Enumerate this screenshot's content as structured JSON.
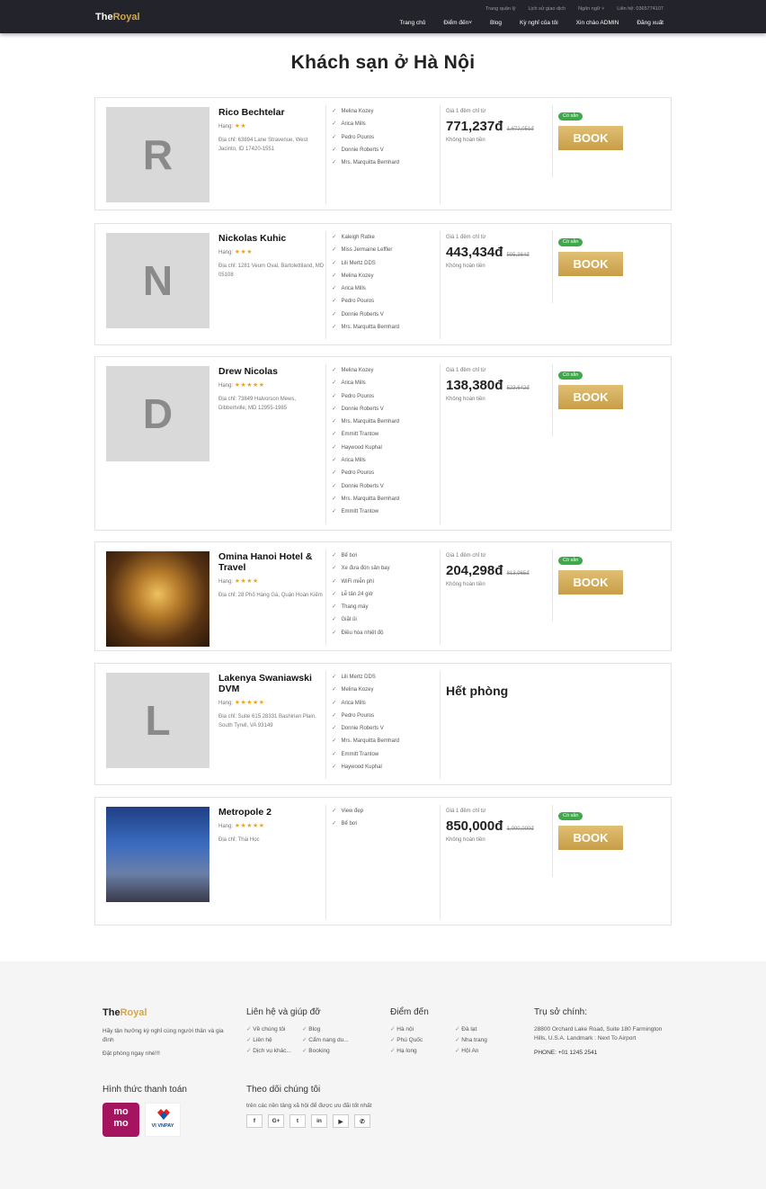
{
  "header": {
    "logo_a": "The",
    "logo_b": "Royal",
    "top_links": [
      "Trang quản lý",
      "Lịch sử giao dịch",
      "Ngôn ngữ ˅",
      "Liên hệ: 0365774107"
    ],
    "nav": [
      "Trang chủ",
      "Điểm đến˅",
      "Blog",
      "Kỳ nghỉ của tôi",
      "Xin chào ADMIN",
      "Đăng xuất"
    ]
  },
  "page_title": "Khách sạn ở Hà Nội",
  "labels": {
    "rank": "Hạng:",
    "price_from": "Giá 1 đêm chỉ từ",
    "refund": "Không hoàn tiền",
    "available": "Có sẵn",
    "book": "BOOK",
    "sold_out": "Hết phòng"
  },
  "hotels": [
    {
      "letter": "R",
      "name": "Rico Bechtelar",
      "stars": "★★",
      "address": "Địa chỉ: 63894 Lane Stravenue, West Jacinto, ID 17420-1551",
      "amenities": [
        "Melina Kozey",
        "Arica Mills",
        "Pedro Pouros",
        "Donnie Roberts V",
        "Mrs. Marquitta Bernhard"
      ],
      "price": "771,237đ",
      "old_price": "1,672,051đ"
    },
    {
      "letter": "N",
      "name": "Nickolas Kuhic",
      "stars": "★★★",
      "address": "Địa chỉ: 1281 Veum Oval, Bartolettiland, MD 05108",
      "amenities": [
        "Kaleigh Ratke",
        "Miss Jermaine Leffler",
        "Lili Mertz DDS",
        "Melina Kozey",
        "Arica Mills",
        "Pedro Pouros",
        "Donnie Roberts V",
        "Mrs. Marquitta Bernhard"
      ],
      "price": "443,434đ",
      "old_price": "595,364đ"
    },
    {
      "letter": "D",
      "name": "Drew Nicolas",
      "stars": "★★★★★",
      "address": "Địa chỉ: 73849 Halvorson Mews, Dibbertville, MD 12955-1985",
      "amenities": [
        "Melina Kozey",
        "Arica Mills",
        "Pedro Pouros",
        "Donnie Roberts V",
        "Mrs. Marquitta Bernhard",
        "Emmitt Trantow",
        "Haywood Kuphal",
        "Arica Mills",
        "Pedro Pouros",
        "Donnie Roberts V",
        "Mrs. Marquitta Bernhard",
        "Emmitt Trantow"
      ],
      "price": "138,380đ",
      "old_price": "523,642đ"
    },
    {
      "letter": "",
      "name": "Omina Hanoi Hotel & Travel",
      "stars": "★★★★",
      "address": "Địa chỉ: 28 Phố Hàng Gà, Quận Hoàn Kiếm",
      "amenities": [
        "Bể bơi",
        "Xe đưa đón sân bay",
        "WiFi miễn phí",
        "Lễ tân 24 giờ",
        "Thang máy",
        "Giặt ủi",
        "Điều hòa nhiệt độ"
      ],
      "price": "204,298đ",
      "old_price": "813,965đ"
    },
    {
      "letter": "L",
      "name": "Lakenya Swaniawski DVM",
      "stars": "★★★★★",
      "address": "Địa chỉ: Suite 615 28331 Bashirian Plain, South Tyrell, VA 93149",
      "amenities": [
        "Lili Mertz DDS",
        "Melina Kozey",
        "Arica Mills",
        "Pedro Pouros",
        "Donnie Roberts V",
        "Mrs. Marquitta Bernhard",
        "Emmitt Trantow",
        "Haywood Kuphal"
      ],
      "price": "",
      "old_price": ""
    },
    {
      "letter": "",
      "name": "Metropole 2",
      "stars": "★★★★★",
      "address": "Địa chỉ: Thái Học",
      "amenities": [
        "View đẹp",
        "Bể bơi"
      ],
      "price": "850,000đ",
      "old_price": "1,000,000đ"
    }
  ],
  "footer": {
    "logo_a": "The",
    "logo_b": "Royal",
    "tagline": "Hãy tận hưởng kỳ nghỉ cùng người thân và gia đình",
    "cta": "Đặt phòng ngay nhé!!!",
    "contact_title": "Liên hệ và giúp đỡ",
    "contact_links": [
      "Về chúng tôi",
      "Blog",
      "Liên hệ",
      "Cẩm nang du...",
      "Dịch vụ khác...",
      "Booking"
    ],
    "dest_title": "Điểm đến",
    "dest_links": [
      "Hà nội",
      "Đà lạt",
      "Phú Quốc",
      "Nha trang",
      "Hạ long",
      "Hội An"
    ],
    "hq_title": "Trụ sở chính:",
    "hq_address": "28800 Orchard Lake Road, Suite 180 Farmington Hills, U.S.A. Landmark : Next To Airport",
    "phone": "PHONE: +01 1245 2541",
    "pay_title": "Hình thức thanh toán",
    "momo_a": "mo",
    "momo_b": "mo",
    "vnpay": "VI VNPAY",
    "follow_title": "Theo dõi chúng tôi",
    "follow_desc": "trên các nền tảng xã hội để được ưu đãi tốt nhất",
    "social": [
      "f",
      "G+",
      "t",
      "in",
      "yt",
      "wa"
    ]
  },
  "colors": {
    "header_bg": "#23232b",
    "gold": "#d4a84a",
    "badge_green": "#3fa84a",
    "star": "#f2a516"
  }
}
